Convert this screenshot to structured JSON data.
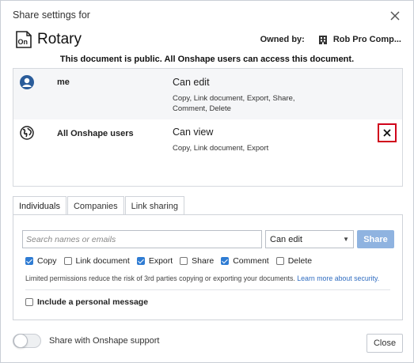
{
  "dialog": {
    "title": "Share settings for"
  },
  "document": {
    "name": "Rotary",
    "owned_by_label": "Owned by:",
    "owner": "Rob Pro Comp..."
  },
  "public_notice": "This document is public. All Onshape users can access this document.",
  "users": [
    {
      "name": "me",
      "permission": "Can edit",
      "details": "Copy, Link document, Export, Share, Comment, Delete",
      "icon": "user-avatar-icon"
    },
    {
      "name": "All Onshape users",
      "permission": "Can view",
      "details": "Copy, Link document, Export",
      "icon": "globe-icon",
      "remove_label": "✕"
    }
  ],
  "tabs": [
    {
      "label": "Individuals",
      "active": true
    },
    {
      "label": "Companies",
      "active": false
    },
    {
      "label": "Link sharing",
      "active": false
    }
  ],
  "share_form": {
    "search_placeholder": "Search names or emails",
    "permission_value": "Can edit",
    "share_label": "Share",
    "permissions": [
      {
        "label": "Copy",
        "checked": true
      },
      {
        "label": "Link document",
        "checked": false
      },
      {
        "label": "Export",
        "checked": true
      },
      {
        "label": "Share",
        "checked": false
      },
      {
        "label": "Comment",
        "checked": true
      },
      {
        "label": "Delete",
        "checked": false
      }
    ],
    "limits_text": "Limited permissions reduce the risk of 3rd parties copying or exporting your documents.",
    "limits_link": "Learn more about security.",
    "personal_message_label": "Include a personal message",
    "personal_message_checked": false
  },
  "footer": {
    "support_toggle_label": "Share with Onshape support",
    "support_toggle_on": false,
    "close_label": "Close"
  },
  "colors": {
    "accent": "#2f7cd3",
    "share_button": "#8fb3e0",
    "remove_border": "#d0021b"
  }
}
